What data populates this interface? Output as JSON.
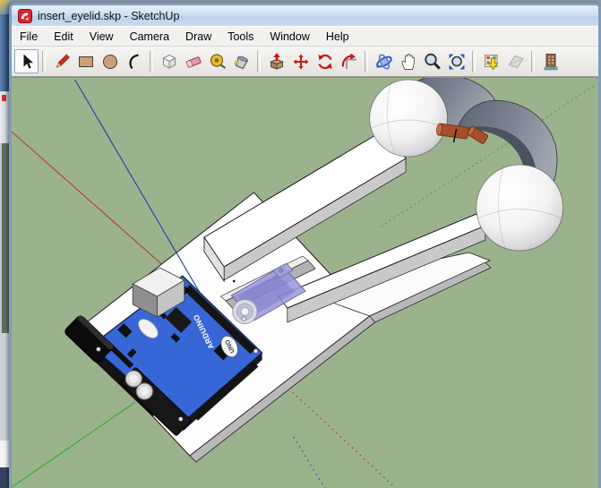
{
  "backdrop": {
    "description": "fragments of desktop icon and another SketchUp window visible along left edge"
  },
  "window": {
    "title": "insert_eyelid.skp - SketchUp",
    "logo_icon": "sketchup-logo"
  },
  "menu_bar": {
    "items": [
      "File",
      "Edit",
      "View",
      "Camera",
      "Draw",
      "Tools",
      "Window",
      "Help"
    ]
  },
  "toolbar": {
    "active_tool": "select",
    "tools": [
      "select",
      "line",
      "rectangle",
      "circle",
      "arc",
      "make-component",
      "eraser",
      "tape-measure",
      "paint-bucket",
      "push-pull",
      "move",
      "rotate",
      "offset",
      "orbit",
      "pan",
      "zoom",
      "zoom-extents",
      "get-models",
      "share-model",
      "photo-textures"
    ]
  },
  "viewport": {
    "background_color": "#9ab38c",
    "axes": {
      "red_axis_color": "#c03028",
      "green_axis_color": "#2fae2f",
      "blue_axis_color": "#2838b8",
      "negative_direction_style": "dotted"
    },
    "model": {
      "arduino_label": "ARDUINO",
      "uno_label": "UNO",
      "parts": [
        "base-plate",
        "rail-upper",
        "rail-lower",
        "eyeball-left",
        "eyeball-right",
        "eyelid-left",
        "eyelid-right",
        "hinge-pin-left",
        "hinge-pin-right",
        "servo-motor",
        "servo-mount-beam",
        "arduino-uno-board",
        "usb-port",
        "power-jack"
      ],
      "colors": {
        "eyeball": "#f2f2f2",
        "eyelid": "#6b7383",
        "board": "#3767d6",
        "servo": "#9a98d8",
        "hinge_pin": "#a84e28",
        "plate": "#ffffff"
      }
    }
  }
}
